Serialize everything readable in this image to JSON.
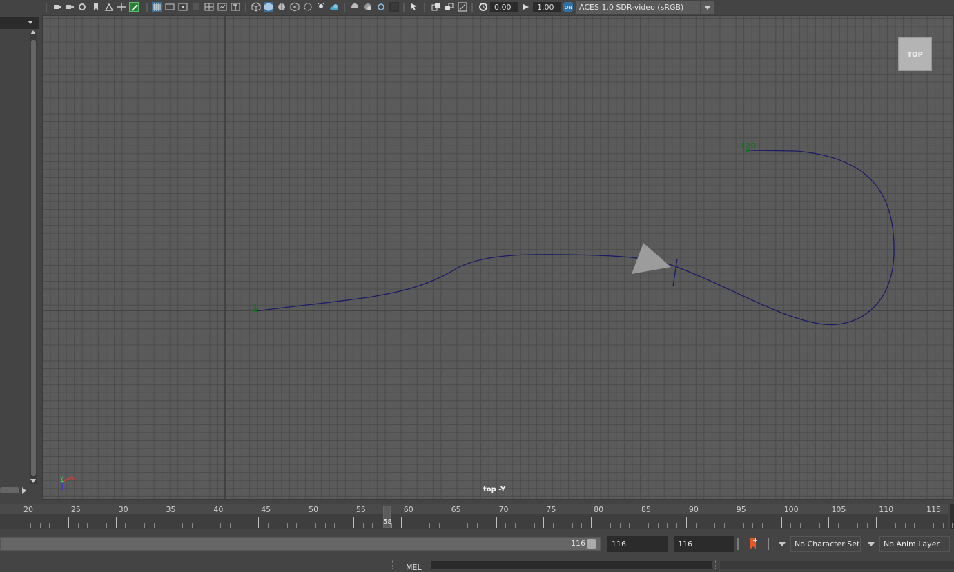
{
  "toolbar": {
    "exposure_value": "0.00",
    "gamma_value": "1.00",
    "color_space": "ACES 1.0 SDR-video (sRGB)",
    "icons": [
      "select-camera-icon",
      "camera-attributes-icon",
      "bookmark-icon",
      "image-plane-icon",
      "2d-pan-zoom-icon",
      "grease-pencil-icon",
      "grid-icon",
      "film-gate-icon",
      "resolution-gate-icon",
      "gate-mask-icon",
      "field-chart-icon",
      "safe-action-icon",
      "safe-title-icon",
      "wireframe-icon",
      "smooth-shade-icon",
      "wireframe-on-shaded-icon",
      "textured-icon",
      "use-all-lights-icon",
      "shadows-icon",
      "screen-space-ao-icon",
      "motion-blur-icon",
      "anti-aliasing-icon",
      "isolate-select-icon",
      "xray-icon",
      "xray-joints-icon",
      "xray-active-icon",
      "backface-culling-icon",
      "exposure-icon",
      "gamma-icon",
      "color-management-icon"
    ]
  },
  "viewport": {
    "view_cube_label": "TOP",
    "camera_label": "top -Y",
    "path_start_label": "1",
    "path_end_label": "120",
    "axis_x": "x",
    "axis_y": "y"
  },
  "timeline": {
    "ticks": [
      "20",
      "25",
      "30",
      "35",
      "40",
      "45",
      "50",
      "55",
      "60",
      "65",
      "70",
      "75",
      "80",
      "85",
      "90",
      "95",
      "100",
      "105",
      "110",
      "115"
    ],
    "current_frame": "58"
  },
  "range": {
    "slider_value": "116",
    "start_field": "116",
    "end_field": "116",
    "character_set": "No Character Set",
    "anim_layer": "No Anim Layer"
  },
  "command_line": {
    "language": "MEL"
  }
}
